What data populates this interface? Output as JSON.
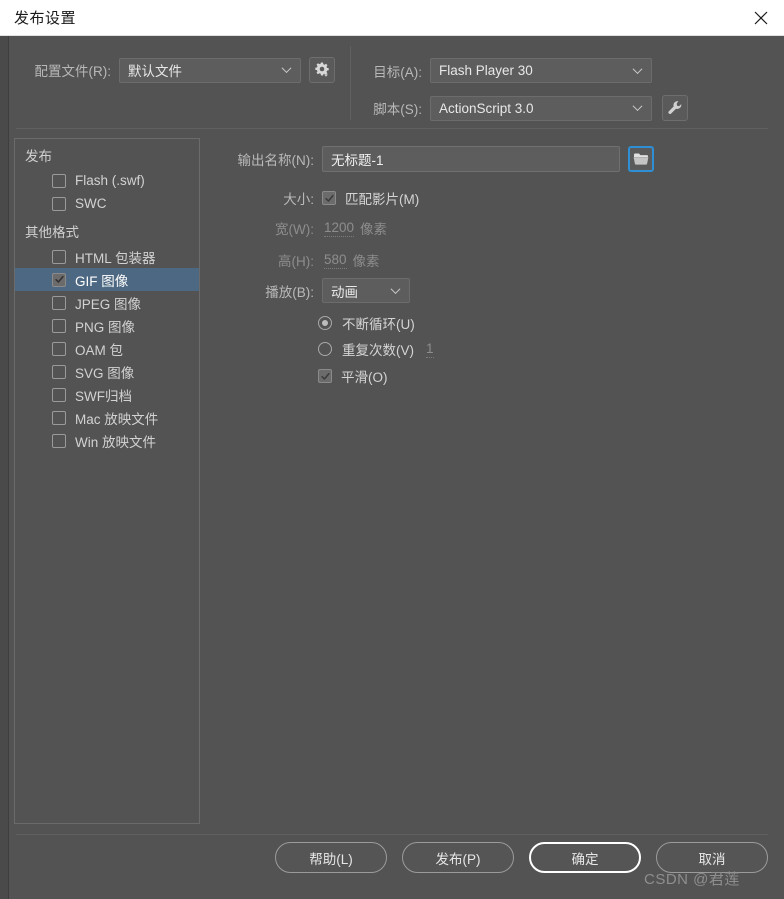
{
  "window": {
    "title": "发布设置",
    "close_icon": "close-icon"
  },
  "header": {
    "profile": {
      "label": "配置文件(R):",
      "value": "默认文件",
      "gear_icon": "gear-icon"
    },
    "target": {
      "label": "目标(A):",
      "value": "Flash Player 30"
    },
    "script": {
      "label": "脚本(S):",
      "value": "ActionScript 3.0",
      "wrench_icon": "wrench-icon"
    }
  },
  "formats_panel": {
    "groups": [
      {
        "title": "发布",
        "items": [
          {
            "label": "Flash (.swf)",
            "checked": false,
            "selected": false
          },
          {
            "label": "SWC",
            "checked": false,
            "selected": false
          }
        ]
      },
      {
        "title": "其他格式",
        "items": [
          {
            "label": "HTML 包装器",
            "checked": false,
            "selected": false
          },
          {
            "label": "GIF 图像",
            "checked": true,
            "selected": true
          },
          {
            "label": "JPEG 图像",
            "checked": false,
            "selected": false
          },
          {
            "label": "PNG 图像",
            "checked": false,
            "selected": false
          },
          {
            "label": "OAM 包",
            "checked": false,
            "selected": false
          },
          {
            "label": "SVG 图像",
            "checked": false,
            "selected": false
          },
          {
            "label": "SWF归档",
            "checked": false,
            "selected": false
          },
          {
            "label": "Mac 放映文件",
            "checked": false,
            "selected": false
          },
          {
            "label": "Win 放映文件",
            "checked": false,
            "selected": false
          }
        ]
      }
    ]
  },
  "settings": {
    "output_name": {
      "label": "输出名称(N):",
      "value": "无标题-1",
      "browse_icon": "folder-icon"
    },
    "size": {
      "label": "大小:",
      "match_movie_label": "匹配影片(M)",
      "match_movie_checked": true
    },
    "width": {
      "label": "宽(W):",
      "value": "1200",
      "unit": "像素"
    },
    "height": {
      "label": "高(H):",
      "value": "580",
      "unit": "像素"
    },
    "playback": {
      "label": "播放(B):",
      "value": "动画"
    },
    "loop_forever": {
      "label": "不断循环(U)",
      "selected": true
    },
    "repeat_count": {
      "label": "重复次数(V)",
      "selected": false,
      "value": "1"
    },
    "smooth": {
      "label": "平滑(O)",
      "checked": true
    }
  },
  "footer": {
    "help_label": "帮助(L)",
    "publish_label": "发布(P)",
    "ok_label": "确定",
    "cancel_label": "取消"
  },
  "watermark": "CSDN @君莲",
  "colors": {
    "dialog_bg": "#535353",
    "titlebar_bg": "#ffffff",
    "selection_blue": "#4d6882",
    "focus_blue": "#2f8fd4"
  }
}
